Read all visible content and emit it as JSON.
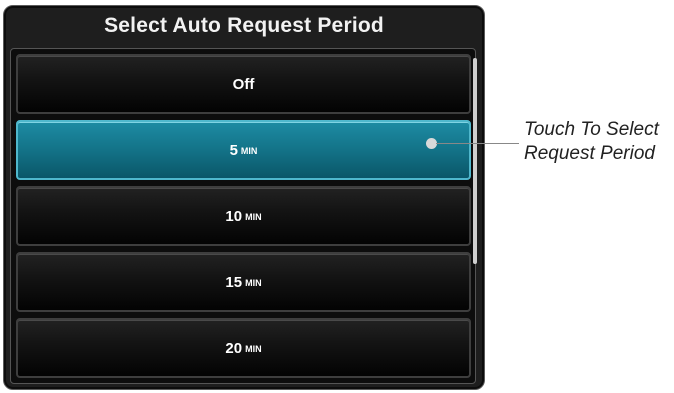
{
  "dialog": {
    "title": "Select Auto Request Period",
    "options": [
      {
        "value": "Off",
        "unit": "",
        "selected": false
      },
      {
        "value": "5",
        "unit": "MIN",
        "selected": true
      },
      {
        "value": "10",
        "unit": "MIN",
        "selected": false
      },
      {
        "value": "15",
        "unit": "MIN",
        "selected": false
      },
      {
        "value": "20",
        "unit": "MIN",
        "selected": false
      }
    ]
  },
  "callout": {
    "line1": "Touch To Select",
    "line2": "Request Period"
  },
  "colors": {
    "panel_bg": "#1e1e1e",
    "selected_bg": "#137388",
    "selected_border": "#4fb7cc",
    "text": "#ffffff"
  }
}
